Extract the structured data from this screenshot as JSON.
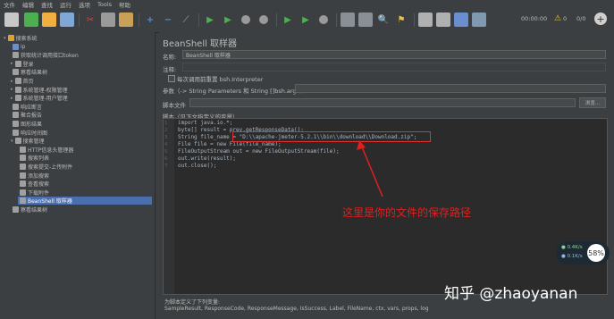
{
  "menu": [
    "文件",
    "编辑",
    "查找",
    "运行",
    "选项",
    "Tools",
    "帮助"
  ],
  "toolbar": {
    "timer": "00:00:00",
    "warnings": "0",
    "threads": "0/0"
  },
  "tree": [
    {
      "label": "搜索系统",
      "indent": 0,
      "icon": "#e0a030",
      "arrow": "▾",
      "sel": false
    },
    {
      "label": "ip",
      "indent": 1,
      "icon": "#6a8fd0",
      "arrow": "",
      "sel": false
    },
    {
      "label": "获取统计调用接口token",
      "indent": 1,
      "icon": "#a0a0a0",
      "arrow": "",
      "sel": false
    },
    {
      "label": "登录",
      "indent": 1,
      "icon": "#a0a0a0",
      "arrow": "▸",
      "sel": false
    },
    {
      "label": "察看结果树",
      "indent": 1,
      "icon": "#a0a0a0",
      "arrow": "",
      "sel": false
    },
    {
      "label": "首页",
      "indent": 1,
      "icon": "#a0a0a0",
      "arrow": "▸",
      "sel": false
    },
    {
      "label": "系统管理-权限管理",
      "indent": 1,
      "icon": "#a0a0a0",
      "arrow": "▸",
      "sel": false
    },
    {
      "label": "系统管理-用户管理",
      "indent": 1,
      "icon": "#a0a0a0",
      "arrow": "▸",
      "sel": false
    },
    {
      "label": "响应断言",
      "indent": 1,
      "icon": "#a0a0a0",
      "arrow": "",
      "sel": false
    },
    {
      "label": "聚合报告",
      "indent": 1,
      "icon": "#a0a0a0",
      "arrow": "",
      "sel": false
    },
    {
      "label": "图形结果",
      "indent": 1,
      "icon": "#a0a0a0",
      "arrow": "",
      "sel": false
    },
    {
      "label": "响应时间图",
      "indent": 1,
      "icon": "#a0a0a0",
      "arrow": "",
      "sel": false
    },
    {
      "label": "搜索管理",
      "indent": 1,
      "icon": "#a0a0a0",
      "arrow": "▾",
      "sel": false
    },
    {
      "label": "HTTP信息头管理器",
      "indent": 2,
      "icon": "#a0a0a0",
      "arrow": "",
      "sel": false
    },
    {
      "label": "搜索列表",
      "indent": 2,
      "icon": "#a0a0a0",
      "arrow": "",
      "sel": false
    },
    {
      "label": "搜索提交-上传附件",
      "indent": 2,
      "icon": "#a0a0a0",
      "arrow": "",
      "sel": false
    },
    {
      "label": "添加搜索",
      "indent": 2,
      "icon": "#a0a0a0",
      "arrow": "",
      "sel": false
    },
    {
      "label": "查看搜索",
      "indent": 2,
      "icon": "#a0a0a0",
      "arrow": "",
      "sel": false
    },
    {
      "label": "下载附件",
      "indent": 2,
      "icon": "#a0a0a0",
      "arrow": "",
      "sel": false
    },
    {
      "label": "BeanShell 取样器",
      "indent": 2,
      "icon": "#a0a0a0",
      "arrow": "",
      "sel": true
    },
    {
      "label": "察看结果树",
      "indent": 1,
      "icon": "#a0a0a0",
      "arrow": "",
      "sel": false
    }
  ],
  "panel": {
    "title": "BeanShell 取样器",
    "name_label": "名称:",
    "name_value": "BeanShell 取样器",
    "comment_label": "注释:",
    "reset_label": "每次调用前重置 bsh.Interpreter",
    "params_label": "参数（-> String Parameters 和 String []bsh.args)",
    "script_file_label": "脚本文件",
    "browse_label": "浏览...",
    "script_label": "脚本（见下文指定义的变量）",
    "vars_label": "为脚本定义了下列变量:",
    "vars_text": "SampleResult, ResponseCode, ResponseMessage, IsSuccess, Label, FileName, ctx, vars, props, log"
  },
  "code": [
    {
      "n": "1",
      "t": "import java.io.*;"
    },
    {
      "n": "2",
      "t": "byte[] result = prev.getResponseData();"
    },
    {
      "n": "3",
      "t": "String file_name = \"D:\\\\apache-jmeter-5.2.1\\\\bin\\\\download\\\\Download.zip\";"
    },
    {
      "n": "4",
      "t": "File file = new File(file_name);"
    },
    {
      "n": "5",
      "t": "FileOutputStream out = new FileOutputStream(file);"
    },
    {
      "n": "6",
      "t": "out.write(result);"
    },
    {
      "n": "7",
      "t": "out.close();"
    }
  ],
  "annotation": "这里是你的文件的保存路径",
  "watermark": "知乎 @zhaoyanan",
  "widget": {
    "up": "0.4K/s",
    "down": "0.1K/s",
    "percent": "58%"
  }
}
